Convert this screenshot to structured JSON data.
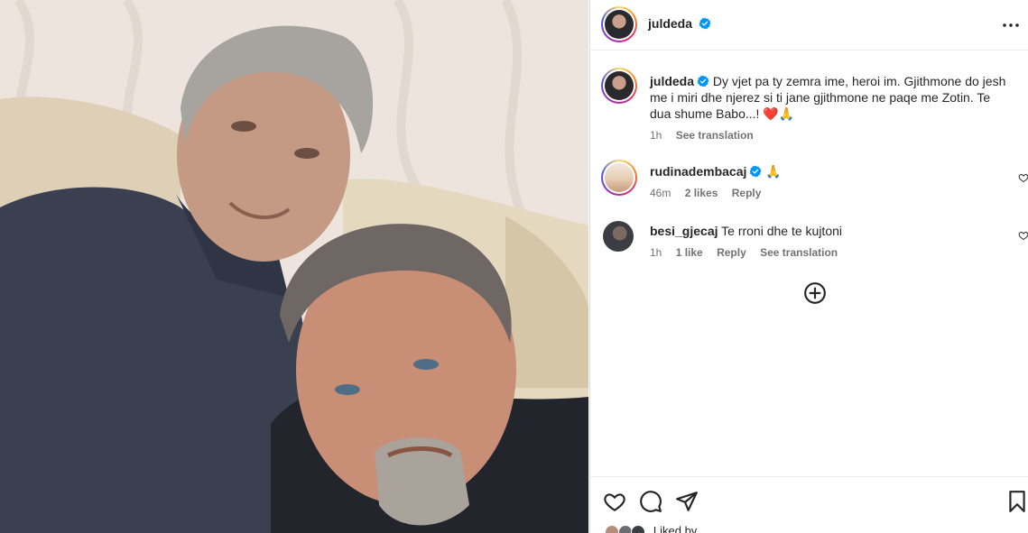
{
  "post": {
    "username": "juldeda",
    "caption_text": "Dy vjet pa ty zemra ime, heroi im. Gjithmone do jesh me i miri dhe njerez si ti jane gjithmone ne paqe me Zotin. Te dua shume Babo...!",
    "caption_emojis": "❤️🙏",
    "time": "1h",
    "see_translation": "See translation"
  },
  "comments": [
    {
      "username": "rudinadembacaj",
      "text": "🙏",
      "time": "46m",
      "likes": "2 likes",
      "reply": "Reply"
    },
    {
      "username": "besi_gjecaj",
      "text": "Te rroni dhe te kujtoni",
      "time": "1h",
      "likes": "1 like",
      "reply": "Reply",
      "see_translation": "See translation"
    }
  ],
  "footer": {
    "liked_by_text": "Liked by"
  },
  "icons": {
    "more": "more-horizontal-icon",
    "verified": "verified-badge-icon",
    "load_more": "plus-circle-icon",
    "like": "heart-icon",
    "comment": "comment-icon",
    "share": "send-icon",
    "save": "bookmark-icon"
  },
  "colors": {
    "verified": "#0095f6",
    "text": "#262626",
    "muted": "#737373"
  }
}
